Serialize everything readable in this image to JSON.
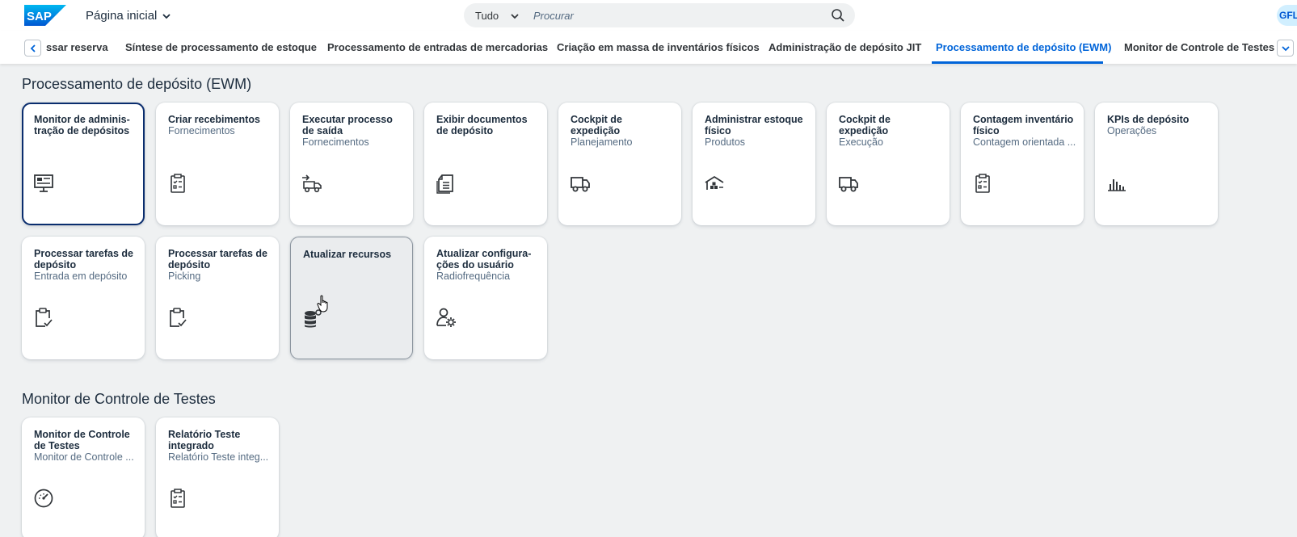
{
  "shell": {
    "logo_text": "SAP",
    "home_title": "Página inicial",
    "search_scope": "Tudo",
    "search_placeholder": "Procurar",
    "avatar_initials": "GFL",
    "brand_color": "#0a6ed1"
  },
  "tabs": [
    {
      "label": "ssar reserva",
      "active": false
    },
    {
      "label": "Síntese de processamento de estoque",
      "active": false
    },
    {
      "label": "Processamento de entradas de mercadorias",
      "active": false
    },
    {
      "label": "Criação em massa de inventários físicos",
      "active": false
    },
    {
      "label": "Administração de depósito JIT",
      "active": false
    },
    {
      "label": "Processamento de depósito (EWM)",
      "active": true
    },
    {
      "label": "Monitor de Controle de Testes",
      "active": false
    }
  ],
  "sections": [
    {
      "title": "Processamento de depósito (EWM)",
      "tiles": [
        {
          "title": "Monitor de adminis-tração de depósitos",
          "subtitle": "",
          "icon": "monitor-icon",
          "state": "focused"
        },
        {
          "title": "Criar recebimentos",
          "subtitle": "Fornecimentos",
          "icon": "clipboard-list-icon"
        },
        {
          "title": "Executar processo de saída",
          "subtitle": "Fornecimentos",
          "icon": "truck-outbound-icon"
        },
        {
          "title": "Exibir documentos de depósito",
          "subtitle": "",
          "icon": "documents-icon"
        },
        {
          "title": "Cockpit de expedição",
          "subtitle": "Planejamento",
          "icon": "truck-icon"
        },
        {
          "title": "Administrar estoque físico",
          "subtitle": "Produtos",
          "icon": "warehouse-icon"
        },
        {
          "title": "Cockpit de expedição",
          "subtitle": "Execução",
          "icon": "truck-icon"
        },
        {
          "title": "Contagem inventário físico",
          "subtitle": "Contagem orientada ...",
          "icon": "clipboard-list-icon"
        },
        {
          "title": "KPIs de depósito",
          "subtitle": "Operações",
          "icon": "bar-chart-icon"
        },
        {
          "title": "Processar tarefas de depósito",
          "subtitle": "Entrada em depósito",
          "icon": "clipboard-check-icon"
        },
        {
          "title": "Processar tarefas de depósito",
          "subtitle": "Picking",
          "icon": "clipboard-check-icon"
        },
        {
          "title": "Atualizar recursos",
          "subtitle": "",
          "icon": "database-icon",
          "state": "hovered"
        },
        {
          "title": "Atualizar configura-ções do usuário",
          "subtitle": "Radiofrequência",
          "icon": "user-settings-icon"
        }
      ]
    },
    {
      "title": "Monitor de Controle de Testes",
      "tiles": [
        {
          "title": "Monitor de Controle de Testes",
          "subtitle": "Monitor de Controle ...",
          "icon": "gauge-icon"
        },
        {
          "title": "Relatório Teste integrado",
          "subtitle": "Relatório Teste integ...",
          "icon": "clipboard-list-icon"
        }
      ]
    }
  ]
}
